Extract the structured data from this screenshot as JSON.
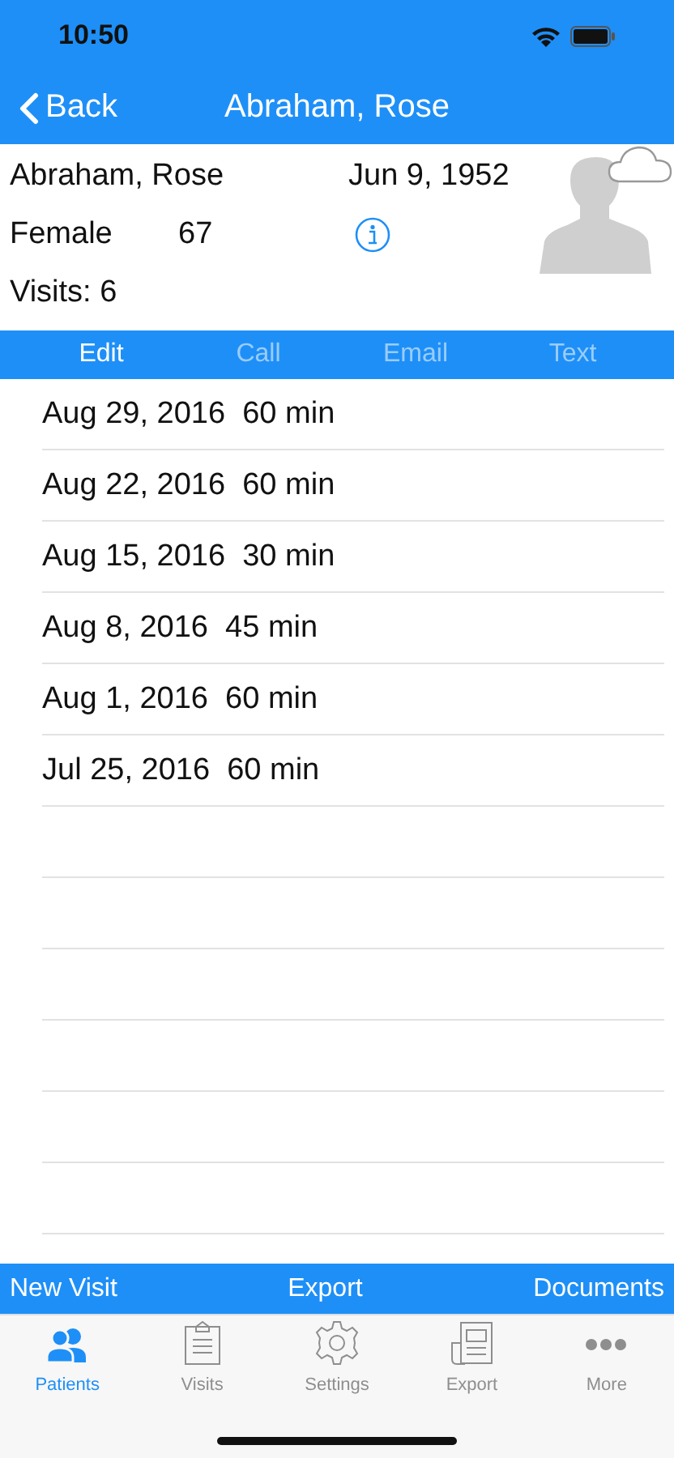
{
  "status_bar": {
    "time": "10:50"
  },
  "nav": {
    "back": "Back",
    "title": "Abraham, Rose"
  },
  "patient": {
    "name": "Abraham, Rose",
    "birth_date": "Jun 9, 1952",
    "gender": "Female",
    "age": "67",
    "visits": "Visits: 6"
  },
  "actions": [
    {
      "label": "Edit",
      "disabled": false
    },
    {
      "label": "Call",
      "disabled": true
    },
    {
      "label": "Email",
      "disabled": true
    },
    {
      "label": "Text",
      "disabled": true
    }
  ],
  "visit_rows": [
    {
      "date": "Aug 29, 2016",
      "duration": "60 min"
    },
    {
      "date": "Aug 22, 2016",
      "duration": "60 min"
    },
    {
      "date": "Aug 15, 2016",
      "duration": "30 min"
    },
    {
      "date": "Aug 8, 2016",
      "duration": "45 min"
    },
    {
      "date": "Aug 1, 2016",
      "duration": "60 min"
    },
    {
      "date": "Jul 25, 2016",
      "duration": "60 min"
    }
  ],
  "bottom_actions": [
    "New Visit",
    "Export",
    "Documents"
  ],
  "tabs": [
    {
      "label": "Patients",
      "kind": "patients",
      "selected": true
    },
    {
      "label": "Visits",
      "kind": "visits",
      "selected": false
    },
    {
      "label": "Settings",
      "kind": "settings",
      "selected": false
    },
    {
      "label": "Export",
      "kind": "export",
      "selected": false
    },
    {
      "label": "More",
      "kind": "more",
      "selected": false
    }
  ]
}
